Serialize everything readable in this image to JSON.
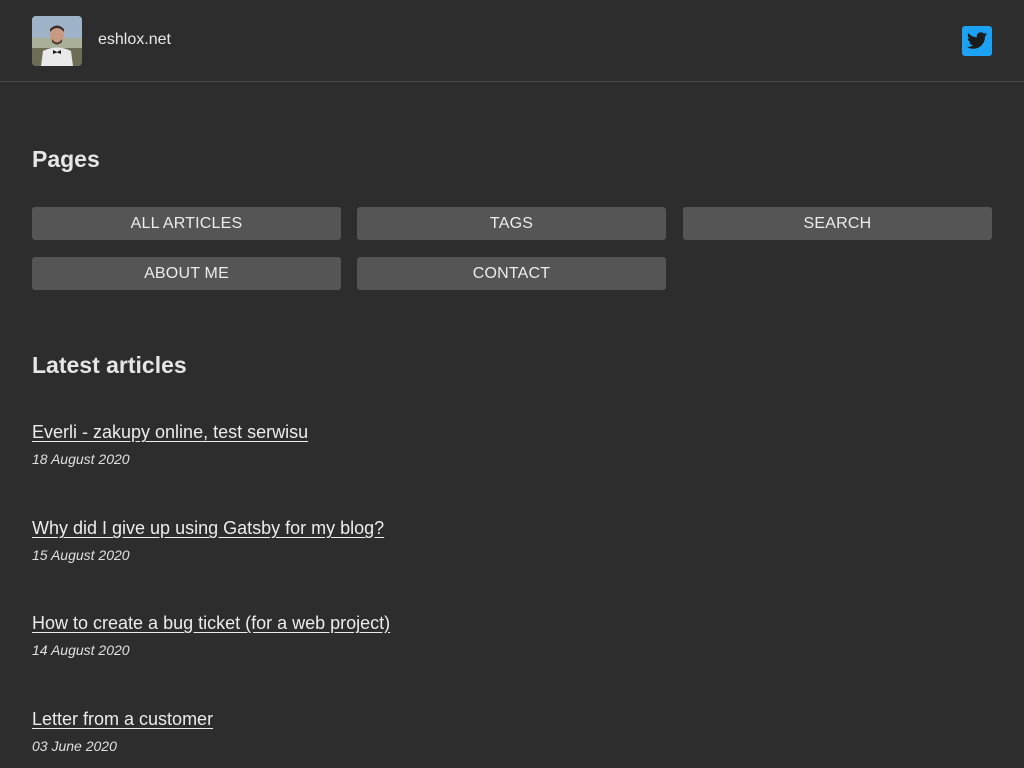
{
  "header": {
    "site_name": "eshlox.net",
    "avatar_icon": "profile-photo",
    "social_icon": "twitter-icon",
    "social_color": "#1da1f2"
  },
  "pages": {
    "title": "Pages",
    "buttons": [
      {
        "label": "ALL ARTICLES"
      },
      {
        "label": "TAGS"
      },
      {
        "label": "SEARCH"
      },
      {
        "label": "ABOUT ME"
      },
      {
        "label": "CONTACT"
      }
    ]
  },
  "latest": {
    "title": "Latest articles",
    "articles": [
      {
        "title": "Everli - zakupy online, test serwisu",
        "date": "18 August 2020"
      },
      {
        "title": "Why did I give up using Gatsby for my blog?",
        "date": "15 August 2020"
      },
      {
        "title": "How to create a bug ticket (for a web project)",
        "date": "14 August 2020"
      },
      {
        "title": "Letter from a customer",
        "date": "03 June 2020"
      }
    ]
  },
  "colors": {
    "background": "#2d2d2d",
    "button": "#555555",
    "text": "#e6e6e6"
  }
}
